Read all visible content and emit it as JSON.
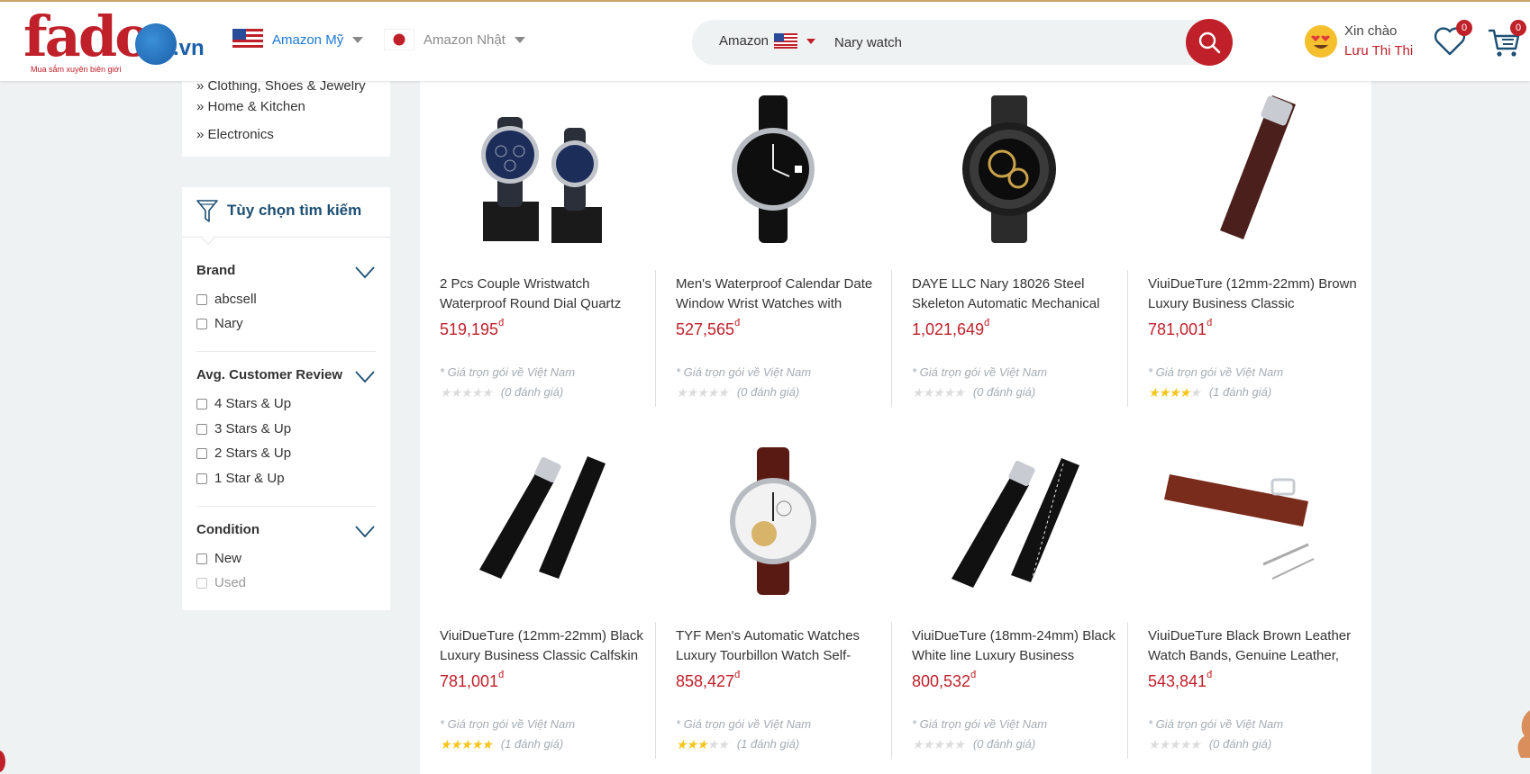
{
  "header": {
    "logo_text": "fado",
    "logo_suffix": ".vn",
    "logo_tagline": "Mua sắm xuyên biên giới",
    "regions": [
      {
        "label": "Amazon Mỹ",
        "flag": "us-flag-icon"
      },
      {
        "label": "Amazon Nhật",
        "flag": "jp-flag-icon"
      }
    ],
    "search": {
      "source_label": "Amazon",
      "value": "Nary watch",
      "placeholder": ""
    },
    "user": {
      "greeting": "Xin chào",
      "name": "Lưu Thi Thi"
    },
    "wishlist_count": "0",
    "cart_count": "0"
  },
  "sidebar": {
    "categories": [
      "Clothing, Shoes & Jewelry",
      "Home & Kitchen",
      "Electronics"
    ],
    "filter_title": "Tùy chọn tìm kiếm",
    "sections": [
      {
        "title": "Brand",
        "options": [
          {
            "label": "abcsell",
            "disabled": false
          },
          {
            "label": "Nary",
            "disabled": false
          }
        ]
      },
      {
        "title": "Avg. Customer Review",
        "options": [
          {
            "label": "4 Stars & Up",
            "disabled": false
          },
          {
            "label": "3 Stars & Up",
            "disabled": false
          },
          {
            "label": "2 Stars & Up",
            "disabled": false
          },
          {
            "label": "1 Star & Up",
            "disabled": false
          }
        ]
      },
      {
        "title": "Condition",
        "options": [
          {
            "label": "New",
            "disabled": false
          },
          {
            "label": "Used",
            "disabled": true
          }
        ]
      }
    ]
  },
  "products": [
    {
      "title": "2 Pcs Couple Wristwatch Waterproof Round Dial Quartz",
      "price": "519,195",
      "currency": "đ",
      "note": "* Giá trọn gói về Việt Nam",
      "stars": 0,
      "reviews": "(0 đánh giá)",
      "image": "couple-watch"
    },
    {
      "title": "Men's Waterproof Calendar Date Window Wrist Watches with",
      "price": "527,565",
      "currency": "đ",
      "note": "* Giá trọn gói về Việt Nam",
      "stars": 0,
      "reviews": "(0 đánh giá)",
      "image": "black-dial-watch"
    },
    {
      "title": "DAYE LLC Nary 18026 Steel Skeleton Automatic Mechanical",
      "price": "1,021,649",
      "currency": "đ",
      "note": "* Giá trọn gói về Việt Nam",
      "stars": 0,
      "reviews": "(0 đánh giá)",
      "image": "skeleton-watch"
    },
    {
      "title": "ViuiDueTure (12mm-22mm) Brown Luxury Business Classic",
      "price": "781,001",
      "currency": "đ",
      "note": "* Giá trọn gói về Việt Nam",
      "stars": 4,
      "reviews": "(1 đánh giá)",
      "image": "brown-strap"
    },
    {
      "title": "ViuiDueTure (12mm-22mm) Black Luxury Business Classic Calfskin",
      "price": "781,001",
      "currency": "đ",
      "note": "* Giá trọn gói về Việt Nam",
      "stars": 5,
      "reviews": "(1 đánh giá)",
      "image": "black-strap"
    },
    {
      "title": "TYF Men's Automatic Watches Luxury Tourbillon Watch Self-",
      "price": "858,427",
      "currency": "đ",
      "note": "* Giá trọn gói về Việt Nam",
      "stars": 3,
      "reviews": "(1 đánh giá)",
      "image": "tourbillon-watch"
    },
    {
      "title": "ViuiDueTure (18mm-24mm) Black White line Luxury Business",
      "price": "800,532",
      "currency": "đ",
      "note": "* Giá trọn gói về Việt Nam",
      "stars": 0,
      "reviews": "(0 đánh giá)",
      "image": "black-white-strap"
    },
    {
      "title": "ViuiDueTure Black Brown Leather Watch Bands, Genuine Leather,",
      "price": "543,841",
      "currency": "đ",
      "note": "* Giá trọn gói về Việt Nam",
      "stars": 0,
      "reviews": "(0 đánh giá)",
      "image": "brown-band"
    }
  ],
  "colors": {
    "brand_red": "#c0202a",
    "brand_blue": "#1b5fa8",
    "star": "#f5c518"
  }
}
